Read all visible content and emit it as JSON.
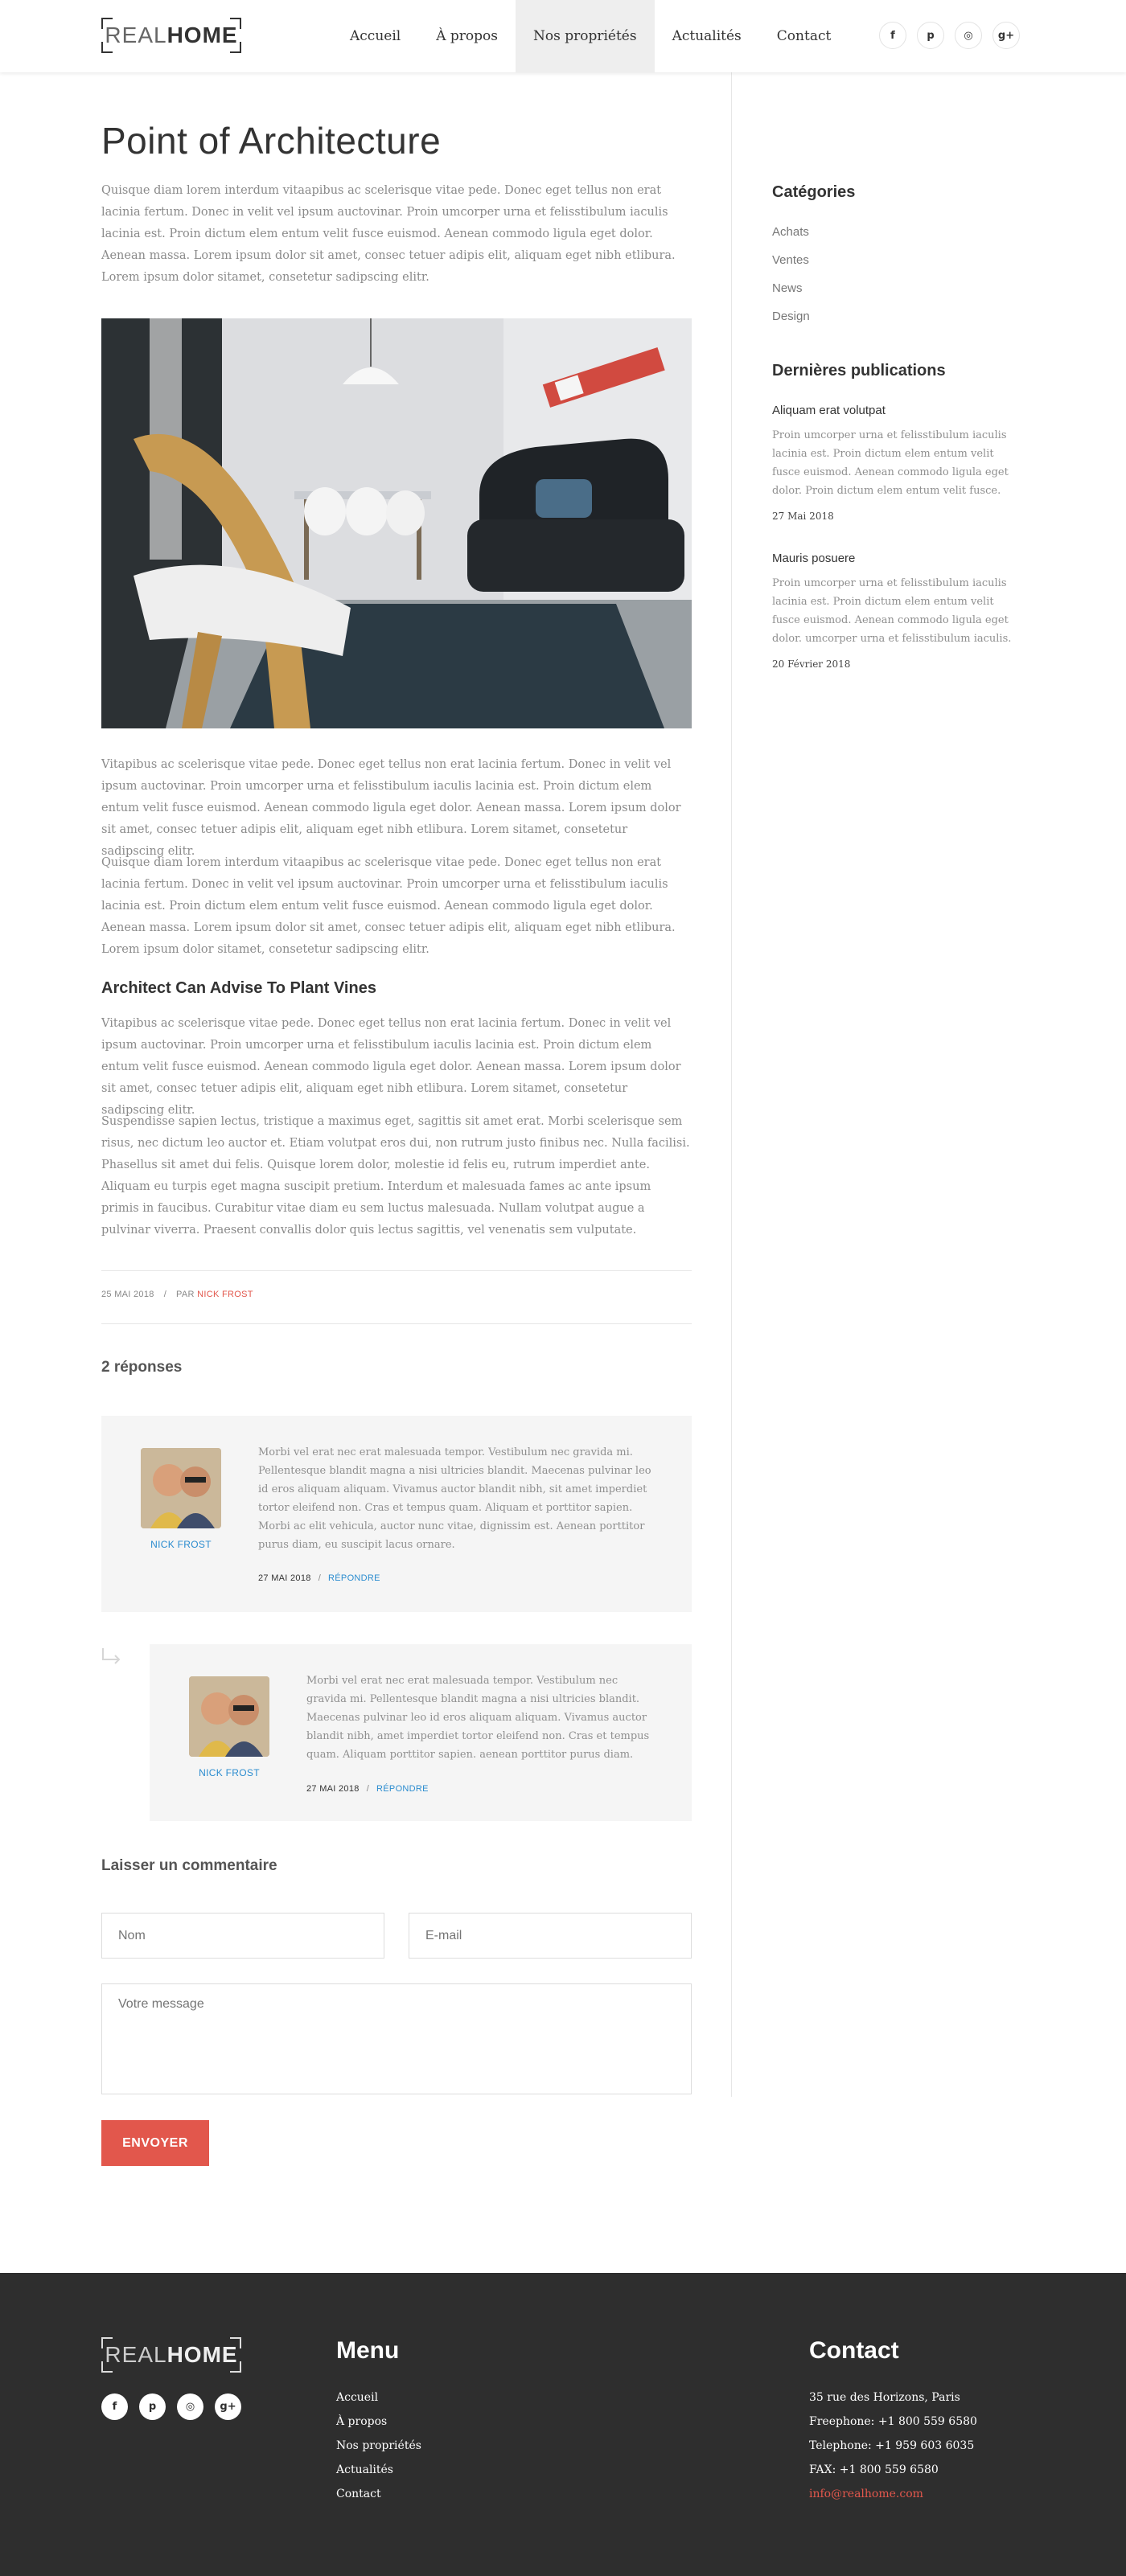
{
  "header": {
    "logo": {
      "light": "REAL",
      "bold": "HOME"
    },
    "nav": [
      {
        "label": "Accueil"
      },
      {
        "label": "À propos"
      },
      {
        "label": "Nos propriétés",
        "active": true
      },
      {
        "label": "Actualités"
      },
      {
        "label": "Contact"
      }
    ],
    "social": [
      "f",
      "p",
      "◎",
      "g+"
    ]
  },
  "article": {
    "title": "Point of Architecture",
    "intro": "Quisque diam lorem interdum vitaapibus ac scelerisque vitae pede. Donec eget tellus non erat lacinia fertum. Donec in velit vel ipsum auctovinar. Proin umcorper urna et felisstibulum iaculis lacinia est. Proin dictum elem entum velit fusce euismod. Aenean commodo ligula eget dolor. Aenean massa. Lorem ipsum dolor sit amet, consec tetuer adipis elit, aliquam eget nibh etlibura. Lorem ipsum dolor sitamet, consetetur sadipscing elitr.",
    "para2": "Vitapibus ac scelerisque vitae pede. Donec eget tellus non erat lacinia fertum. Donec in velit vel ipsum auctovinar. Proin umcorper urna et felisstibulum iaculis lacinia est. Proin dictum elem entum velit fusce euismod. Aenean commodo ligula eget dolor. Aenean massa. Lorem ipsum dolor sit amet, consec tetuer adipis elit, aliquam eget nibh etlibura. Lorem sitamet, consetetur sadipscing elitr.",
    "para3": "Quisque diam lorem interdum vitaapibus ac scelerisque vitae pede. Donec eget tellus non erat lacinia fertum. Donec in velit vel ipsum auctovinar. Proin umcorper urna et felisstibulum iaculis lacinia est. Proin dictum elem entum velit fusce euismod. Aenean commodo ligula eget dolor. Aenean massa. Lorem ipsum dolor sit amet, consec tetuer adipis elit, aliquam eget nibh etlibura. Lorem ipsum dolor sitamet, consetetur sadipscing elitr.",
    "subtitle": "Architect Can Advise To Plant Vines",
    "para4": "Vitapibus ac scelerisque vitae pede. Donec eget tellus non erat lacinia fertum. Donec in velit vel ipsum auctovinar. Proin umcorper urna et felisstibulum iaculis lacinia est. Proin dictum elem entum velit fusce euismod. Aenean commodo ligula eget dolor. Aenean massa. Lorem ipsum dolor sit amet, consec tetuer adipis elit, aliquam eget nibh etlibura. Lorem sitamet, consetetur sadipscing elitr.",
    "para5": "Suspendisse sapien lectus, tristique a maximus eget, sagittis sit amet erat. Morbi scelerisque sem risus, nec dictum leo auctor et. Etiam volutpat eros dui, non rutrum justo finibus nec. Nulla facilisi. Phasellus sit amet dui felis. Quisque lorem dolor, molestie id felis eu, rutrum imperdiet ante. Aliquam eu turpis eget magna suscipit pretium. Interdum et malesuada fames ac ante ipsum primis in faucibus. Curabitur vitae diam eu sem luctus malesuada. Nullam volutpat augue a pulvinar viverra. Praesent convallis dolor quis lectus sagittis, vel venenatis sem vulputate.",
    "meta": {
      "date": "25 MAI 2018",
      "sep": "/",
      "by": "PAR",
      "author": "NICK FROST"
    }
  },
  "comments": {
    "title": "2 réponses",
    "items": [
      {
        "name": "NICK FROST",
        "text": "Morbi vel erat nec erat malesuada tempor. Vestibulum nec gravida mi. Pellentesque blandit magna a nisi ultricies blandit. Maecenas pulvinar leo id eros aliquam aliquam. Vivamus auctor blandit nibh, sit amet imperdiet tortor eleifend non. Cras et tempus quam. Aliquam et porttitor sapien. Morbi ac elit vehicula, auctor nunc vitae, dignissim est. Aenean porttitor purus diam, eu suscipit lacus ornare.",
        "date": "27 MAI 2018",
        "sep": "/",
        "reply": "RÉPONDRE"
      },
      {
        "name": "NICK FROST",
        "text": "Morbi vel erat nec erat malesuada tempor. Vestibulum nec gravida mi. Pellentesque blandit magna a nisi ultricies blandit. Maecenas pulvinar leo id eros aliquam aliquam. Vivamus auctor blandit nibh, amet imperdiet tortor eleifend non. Cras et tempus quam. Aliquam porttitor sapien. aenean porttitor purus diam.",
        "date": "27 MAI 2018",
        "sep": "/",
        "reply": "RÉPONDRE"
      }
    ]
  },
  "form": {
    "title": "Laisser un commentaire",
    "name_placeholder": "Nom",
    "email_placeholder": "E-mail",
    "message_placeholder": "Votre message",
    "submit_label": "ENVOYER"
  },
  "sidebar": {
    "categories_title": "Catégories",
    "categories": [
      "Achats",
      "Ventes",
      "News",
      "Design"
    ],
    "recent_title": "Dernières publications",
    "posts": [
      {
        "title": "Aliquam erat volutpat",
        "excerpt": "Proin umcorper urna et felisstibulum iaculis lacinia est. Proin dictum elem entum velit fusce euismod. Aenean commodo ligula eget dolor. Proin dictum elem entum velit fusce.",
        "date": "27 Mai 2018"
      },
      {
        "title": "Mauris posuere",
        "excerpt": "Proin umcorper urna et felisstibulum iaculis lacinia est. Proin dictum elem entum velit fusce euismod. Aenean commodo ligula eget dolor. umcorper urna et felisstibulum iaculis.",
        "date": "20 Février 2018"
      }
    ]
  },
  "footer": {
    "logo": {
      "light": "REAL",
      "bold": "HOME"
    },
    "social": [
      "f",
      "p",
      "◎",
      "g+"
    ],
    "menu_title": "Menu",
    "menu": [
      "Accueil",
      "À propos",
      "Nos propriétés",
      "Actualités",
      "Contact"
    ],
    "contact_title": "Contact",
    "address": "35 rue des Horizons, Paris",
    "freephone": "Freephone: +1 800 559 6580",
    "telephone": "Telephone: +1 959 603 6035",
    "fax": "FAX: +1 800 559 6580",
    "email": "info@realhome.com"
  },
  "colors": {
    "accent": "#e2574c",
    "link": "#2b8ccf",
    "footer_bg": "#2e2e2e"
  }
}
